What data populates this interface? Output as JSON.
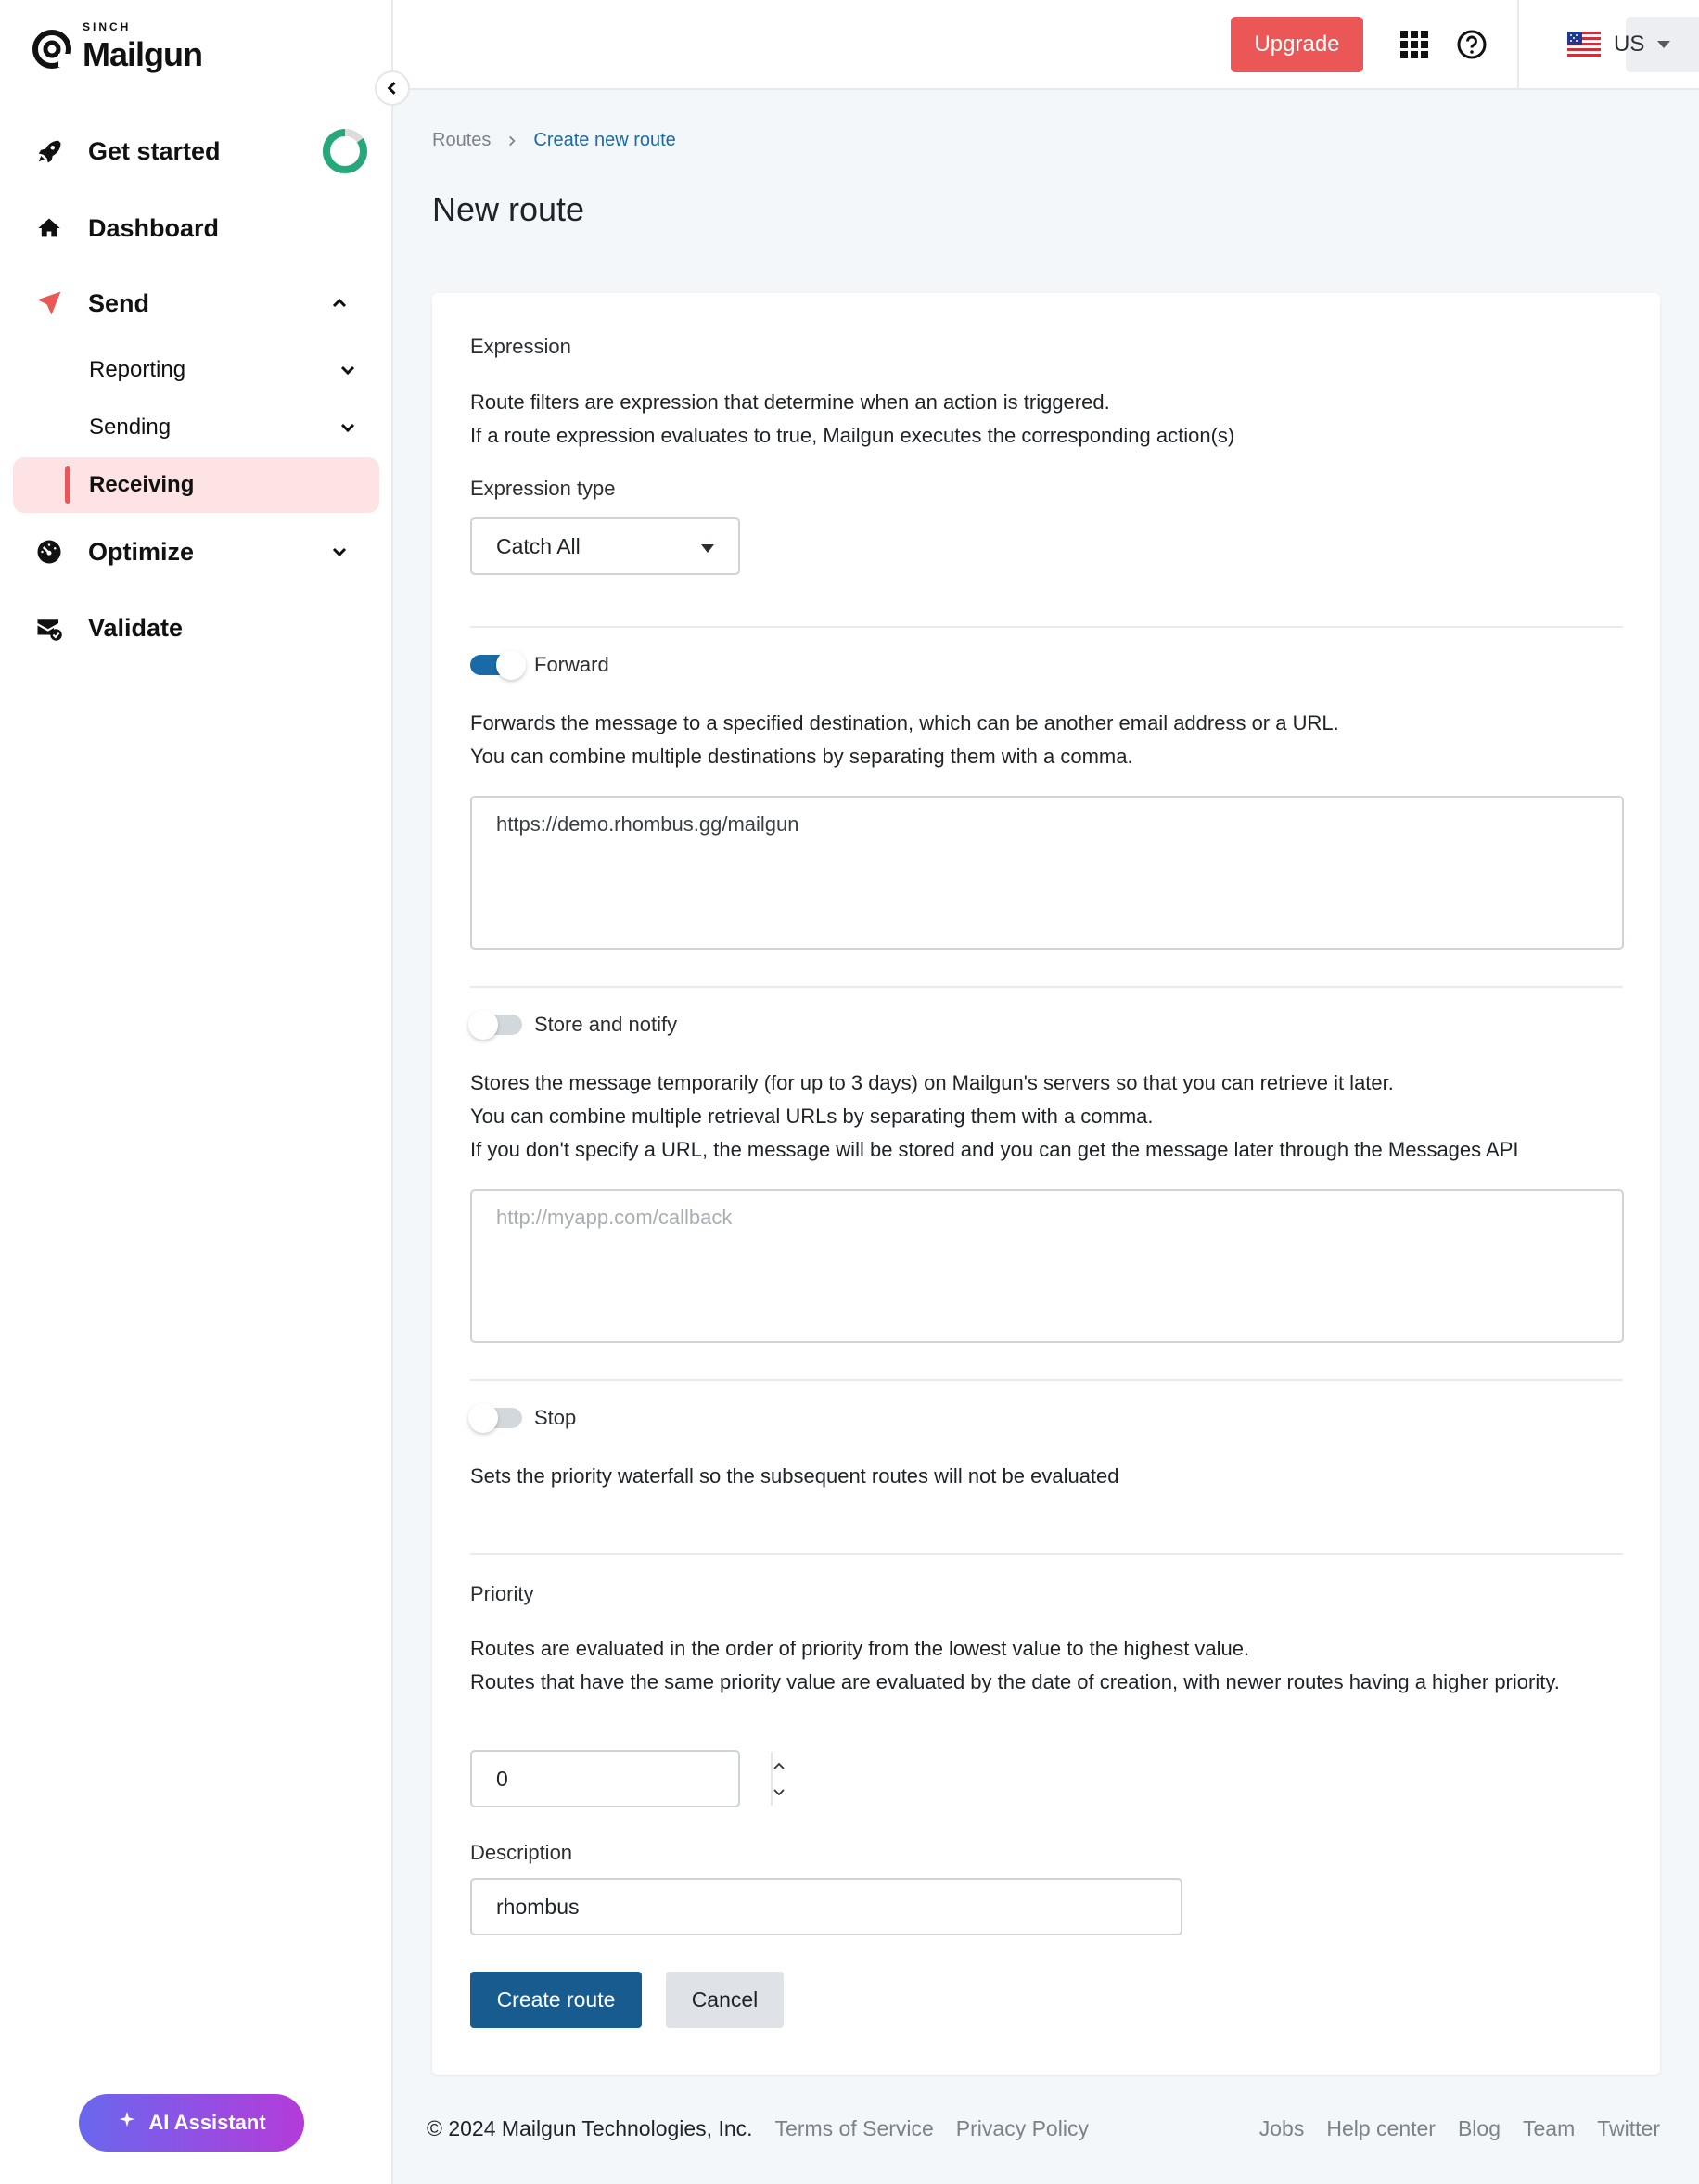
{
  "brand": {
    "company": "SINCH",
    "product": "Mailgun"
  },
  "sidebar": {
    "items": [
      {
        "label": "Get started",
        "icon": "rocket-icon",
        "progress_percent": 85
      },
      {
        "label": "Dashboard",
        "icon": "home-icon"
      },
      {
        "label": "Send",
        "icon": "paper-plane-icon",
        "expanded": true
      },
      {
        "label": "Optimize",
        "icon": "gauge-icon",
        "expanded": false
      },
      {
        "label": "Validate",
        "icon": "mail-check-icon"
      }
    ],
    "send_subitems": [
      {
        "label": "Reporting",
        "expanded": false
      },
      {
        "label": "Sending",
        "expanded": false
      },
      {
        "label": "Receiving",
        "active": true
      }
    ],
    "ai_assistant_label": "AI Assistant"
  },
  "header": {
    "upgrade_label": "Upgrade",
    "region": {
      "label": "US",
      "flag": "us-flag"
    }
  },
  "breadcrumb": {
    "root": "Routes",
    "current": "Create new route"
  },
  "page_title": "New route",
  "form": {
    "expression": {
      "title": "Expression",
      "description_lines": [
        "Route filters are expression that determine when an action is triggered.",
        "If a route expression evaluates to true, Mailgun executes the corresponding action(s)"
      ],
      "type_label": "Expression type",
      "type_value": "Catch All"
    },
    "forward": {
      "label": "Forward",
      "enabled": true,
      "description_lines": [
        "Forwards the message to a specified destination, which can be another email address or a URL.",
        "You can combine multiple destinations by separating them with a comma."
      ],
      "value": "https://demo.rhombus.gg/mailgun"
    },
    "store": {
      "label": "Store and notify",
      "enabled": false,
      "description_lines": [
        "Stores the message temporarily (for up to 3 days) on Mailgun's servers so that you can retrieve it later.",
        "You can combine multiple retrieval URLs by separating them with a comma.",
        "If you don't specify a URL, the message will be stored and you can get the message later through the Messages API"
      ],
      "placeholder": "http://myapp.com/callback"
    },
    "stop": {
      "label": "Stop",
      "enabled": false,
      "description": "Sets the priority waterfall so the subsequent routes will not be evaluated"
    },
    "priority": {
      "title": "Priority",
      "description_lines": [
        "Routes are evaluated in the order of priority from the lowest value to the highest value.",
        "Routes that have the same priority value are evaluated by the date of creation, with newer routes having a higher priority."
      ],
      "value": "0"
    },
    "description": {
      "label": "Description",
      "value": "rhombus"
    },
    "create_label": "Create route",
    "cancel_label": "Cancel"
  },
  "footer": {
    "copyright": "© 2024 Mailgun Technologies, Inc.",
    "left_links": [
      "Terms of Service",
      "Privacy Policy"
    ],
    "right_links": [
      "Jobs",
      "Help center",
      "Blog",
      "Team",
      "Twitter"
    ]
  },
  "colors": {
    "accent_red": "#eb5757",
    "primary_blue": "#175b8f",
    "link_blue": "#1a6aa8",
    "progress_green": "#27a87a",
    "active_bg": "#fde3e3"
  }
}
